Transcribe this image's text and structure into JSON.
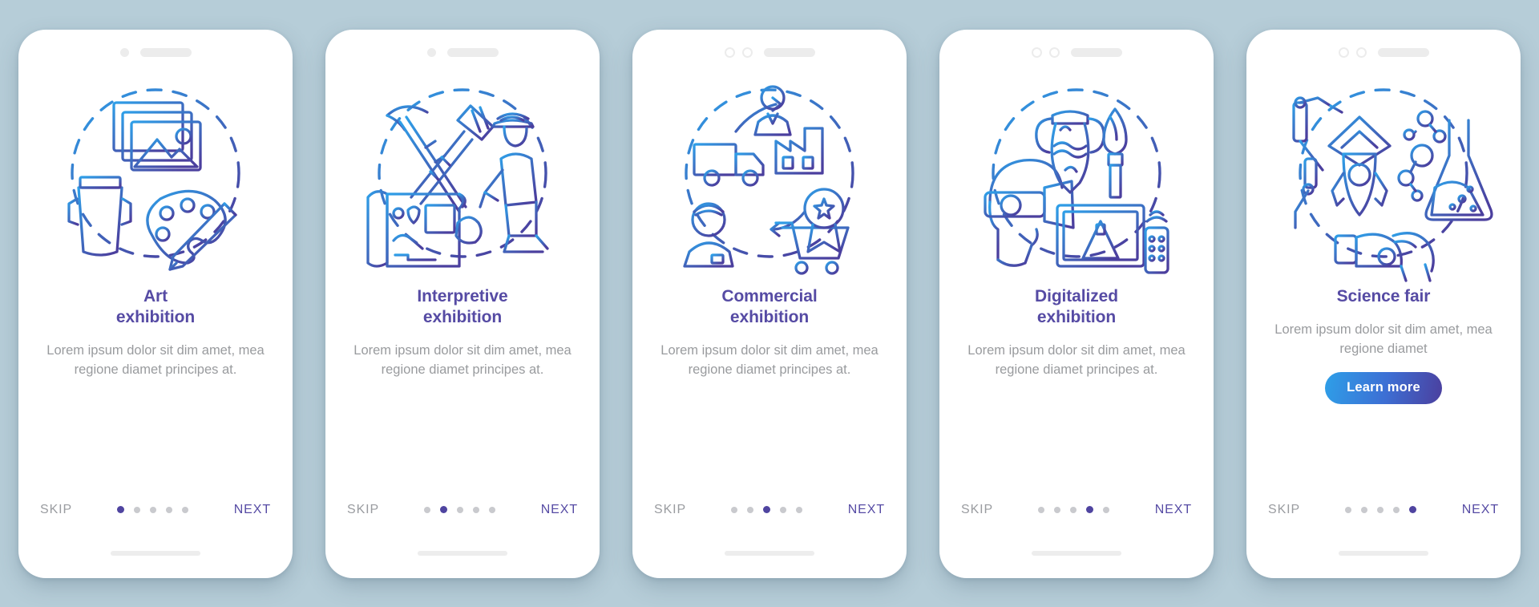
{
  "background_color": "#b6cdd8",
  "theme": {
    "title_color": "#564ba4",
    "body_color": "#999b9e",
    "active_dot_color": "#4f44a0",
    "inactive_dot_color": "#c9cace",
    "icon_gradient_from": "#2e9fe8",
    "icon_gradient_to": "#4b3f9e",
    "button_gradient_from": "#2e9fe8",
    "button_gradient_to": "#4b3f9e"
  },
  "nav": {
    "skip_label": "SKIP",
    "next_label": "NEXT",
    "total_steps": 5
  },
  "screens": [
    {
      "id": "art-exhibition",
      "title_line1": "Art",
      "title_line2": "exhibition",
      "description": "Lorem ipsum dolor sit dim amet, mea regione diamet principes at.",
      "illustration": "art-exhibition-icon",
      "illustration_parts": [
        "photo-frames-icon",
        "drum-icon",
        "paint-palette-icon",
        "paint-brush-icon",
        "dashed-circle"
      ],
      "active_step": 1,
      "has_learn_more": false,
      "status_style": "dot-and-speaker"
    },
    {
      "id": "interpretive-exhibition",
      "title_line1": "Interpretive",
      "title_line2": "exhibition",
      "description": "Lorem ipsum dolor sit dim amet, mea regione diamet principes at.",
      "illustration": "interpretive-exhibition-icon",
      "illustration_parts": [
        "pickaxe-icon",
        "brush-icon",
        "map-scroll-icon",
        "archaeologist-icon",
        "dashed-circle"
      ],
      "active_step": 2,
      "has_learn_more": false,
      "status_style": "dot-and-speaker"
    },
    {
      "id": "commercial-exhibition",
      "title_line1": "Commercial",
      "title_line2": "exhibition",
      "description": "Lorem ipsum dolor sit dim amet, mea regione diamet principes at.",
      "illustration": "commercial-exhibition-icon",
      "illustration_parts": [
        "businessman-icon",
        "truck-icon",
        "factory-icon",
        "shopping-cart-icon",
        "award-star-icon",
        "salesperson-icon",
        "dashed-circle"
      ],
      "active_step": 3,
      "has_learn_more": false,
      "status_style": "two-rings-and-speaker"
    },
    {
      "id": "digitalized-exhibition",
      "title_line1": "Digitalized",
      "title_line2": "exhibition",
      "description": "Lorem ipsum dolor sit dim amet, mea regione diamet principes at.",
      "illustration": "digitalized-exhibition-icon",
      "illustration_parts": [
        "vr-headset-icon",
        "amphora-icon",
        "brush-icon",
        "monitor-pyramid-icon",
        "remote-control-icon",
        "dashed-circle"
      ],
      "active_step": 4,
      "has_learn_more": false,
      "status_style": "two-rings-and-speaker"
    },
    {
      "id": "science-fair",
      "title_line1": "Science fair",
      "title_line2": "",
      "description": "Lorem ipsum dolor sit dim amet, mea regione diamet",
      "illustration": "science-fair-icon",
      "illustration_parts": [
        "robotic-arm-icon",
        "rocket-icon",
        "molecule-icon",
        "flask-icon",
        "robot-dog-icon",
        "dashed-circle"
      ],
      "active_step": 5,
      "has_learn_more": true,
      "learn_more_label": "Learn more",
      "status_style": "two-rings-and-speaker"
    }
  ]
}
